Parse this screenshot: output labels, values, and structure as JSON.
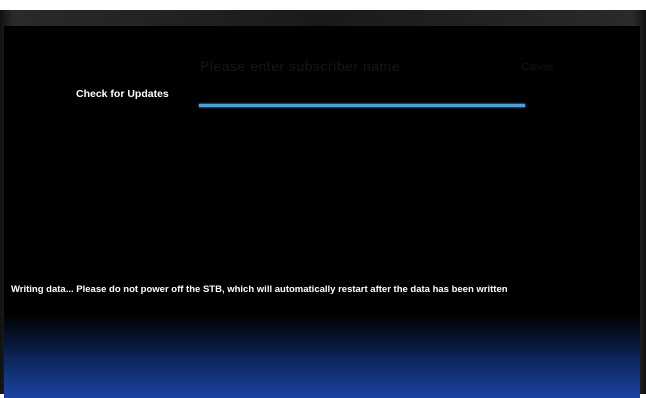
{
  "screen": {
    "ghost_title": "Please enter subscriber name",
    "ghost_right": "Cancel"
  },
  "update": {
    "heading": "Check for Updates",
    "progress": 1.0,
    "status_message": "Writing data... Please do not power off the STB, which will automatically restart after the data has been written"
  },
  "colors": {
    "background": "#000000",
    "progress_bar": "#4d9fd6",
    "bottom_glow": "#1b44a3",
    "text": "#ffffff"
  }
}
